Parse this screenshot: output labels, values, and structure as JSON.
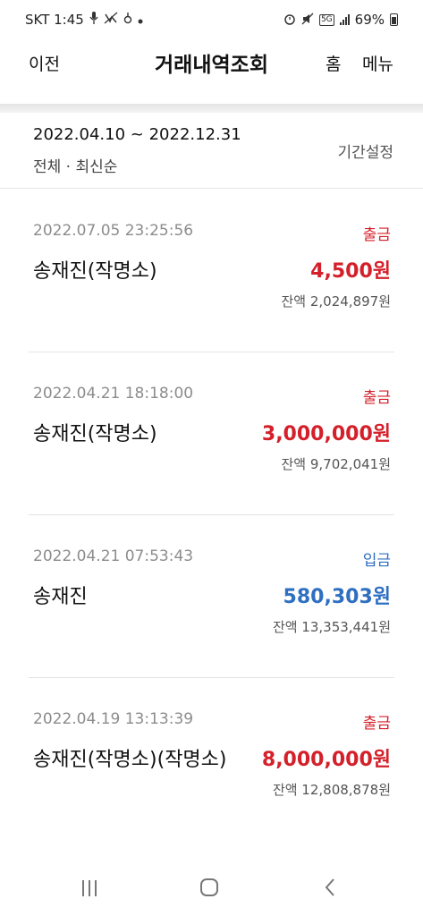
{
  "status_bar": {
    "carrier_time": "SKT 1:45",
    "battery": "69%",
    "network": "5G",
    "icons_left": [
      "mic-icon",
      "no-call-icon",
      "speaker-icon",
      "dot-icon"
    ],
    "icons_right": [
      "alarm-icon",
      "mute-icon",
      "5g-icon",
      "signal-icon",
      "battery-icon"
    ]
  },
  "header": {
    "back_label": "이전",
    "title": "거래내역조회",
    "home_label": "홈",
    "menu_label": "메뉴"
  },
  "filter": {
    "date_range": "2022.04.10 ~ 2022.12.31",
    "summary": "전체 · 최신순",
    "period_button": "기간설정"
  },
  "transactions": [
    {
      "time": "2022.07.05 23:25:56",
      "type": "출금",
      "name": "송재진(작명소)",
      "amount": "4,500원",
      "balance": "잔액 2,024,897원"
    },
    {
      "time": "2022.04.21 18:18:00",
      "type": "출금",
      "name": "송재진(작명소)",
      "amount": "3,000,000원",
      "balance": "잔액 9,702,041원"
    },
    {
      "time": "2022.04.21 07:53:43",
      "type": "입금",
      "name": "송재진",
      "amount": "580,303원",
      "balance": "잔액 13,353,441원"
    },
    {
      "time": "2022.04.19 13:13:39",
      "type": "출금",
      "name": "송재진(작명소)(작명소)",
      "amount": "8,000,000원",
      "balance": "잔액 12,808,878원"
    }
  ],
  "colors": {
    "withdrawal": "#d4202a",
    "deposit": "#2f6fc1"
  },
  "nav_icons": [
    "recent-apps-icon",
    "home-icon",
    "back-icon"
  ]
}
